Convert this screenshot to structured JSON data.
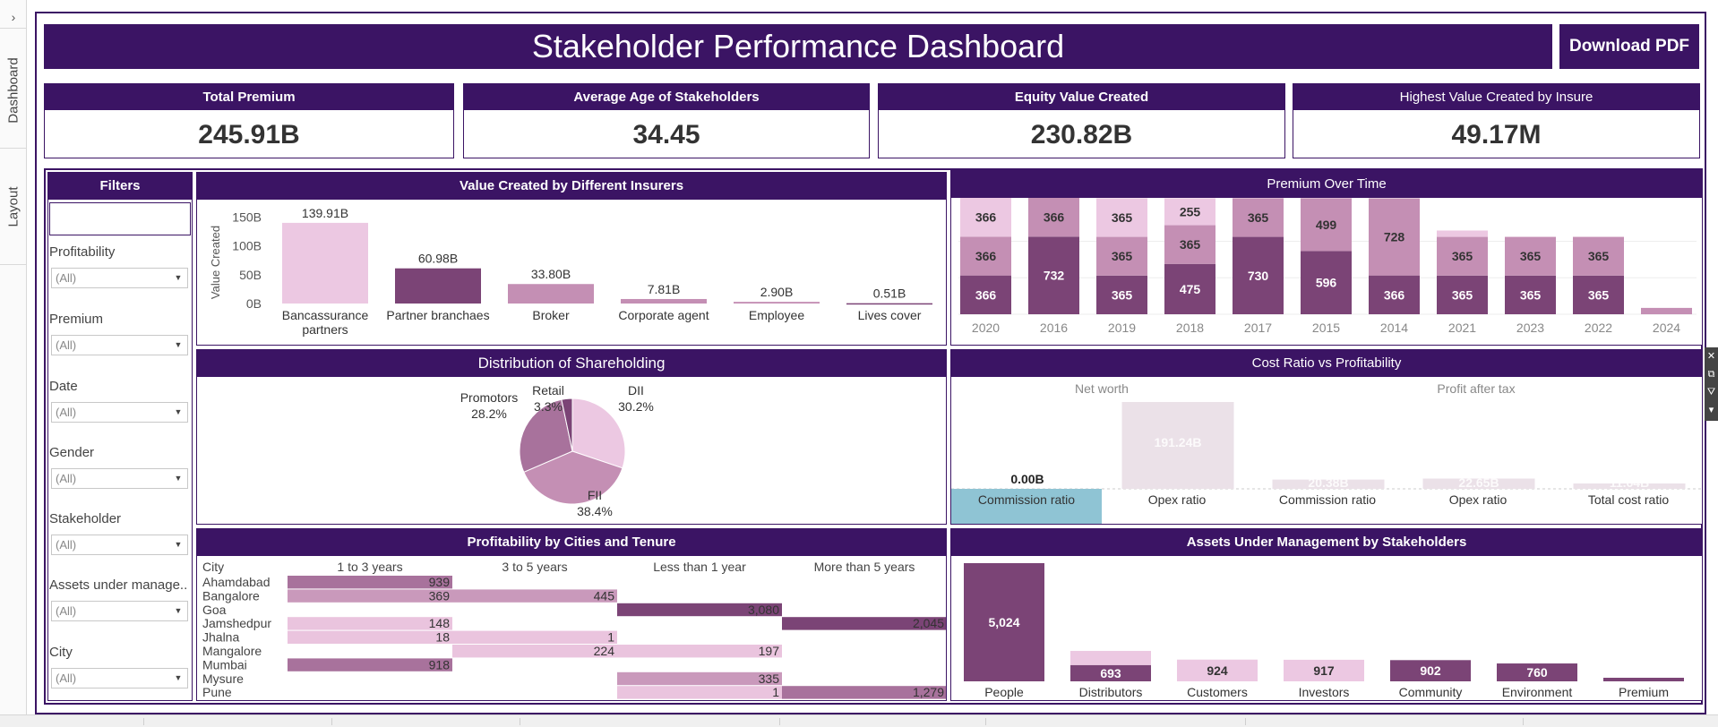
{
  "nav": {
    "expand_glyph": "›",
    "tabs": [
      "Dashboard",
      "Layout"
    ]
  },
  "header": {
    "title": "Stakeholder Performance Dashboard",
    "download_label": "Download PDF"
  },
  "kpis": [
    {
      "label": "Total Premium",
      "value": "245.91B"
    },
    {
      "label": "Average Age of Stakeholders",
      "value": "34.45"
    },
    {
      "label": "Equity  Value Created",
      "value": "230.82B"
    },
    {
      "label": "Highest Value Created by Insure",
      "value": "49.17M"
    }
  ],
  "filters": {
    "title": "Filters",
    "items": [
      {
        "label": "Profitability",
        "value": "(All)"
      },
      {
        "label": "Premium",
        "value": "(All)"
      },
      {
        "label": "Date",
        "value": "(All)"
      },
      {
        "label": "Gender",
        "value": "(All)"
      },
      {
        "label": "Stakeholder",
        "value": "(All)"
      },
      {
        "label": "Assets under manage..",
        "value": "(All)"
      },
      {
        "label": "City",
        "value": "(All)"
      }
    ]
  },
  "panels": {
    "value_created": "Value Created by Different Insurers",
    "premium_over_time": "Premium Over Time",
    "shareholding": "Distribution of Shareholding",
    "cost_ratio": "Cost Ratio vs Profitability",
    "profitability_cities": "Profitability by Cities and Tenure",
    "aum": "Assets Under Management by Stakeholders"
  },
  "colors": {
    "brand": "#3b1464",
    "light": "#ecc8e2",
    "mid": "#c48fb4",
    "dark": "#7b4476",
    "teal": "#8fc4d4"
  },
  "chart_data": [
    {
      "id": "value-created",
      "type": "bar",
      "title": "Value Created by Different Insurers",
      "ylabel": "Value Created",
      "yticks": [
        "150B",
        "100B",
        "50B",
        "0B"
      ],
      "ylim": [
        0,
        160
      ],
      "categories": [
        [
          "Bancassurance",
          "partners"
        ],
        [
          "Partner branchaes"
        ],
        [
          "Broker"
        ],
        [
          "Corporate agent"
        ],
        [
          "Employee"
        ],
        [
          "Lives cover"
        ]
      ],
      "values": [
        139.91,
        60.98,
        33.8,
        7.81,
        2.9,
        0.51
      ],
      "labels": [
        "139.91B",
        "60.98B",
        "33.80B",
        "7.81B",
        "2.90B",
        "0.51B"
      ],
      "shades": [
        "light",
        "dark",
        "mid",
        "mid",
        "mid",
        "dark"
      ]
    },
    {
      "id": "premium-over-time",
      "type": "bar",
      "stacked": true,
      "title": "Premium Over Time",
      "categories": [
        "2020",
        "2016",
        "2019",
        "2018",
        "2017",
        "2015",
        "2014",
        "2021",
        "2023",
        "2022",
        "2024"
      ],
      "series": [
        {
          "shade": "dark",
          "values": [
            366,
            732,
            365,
            475,
            730,
            596,
            366,
            365,
            365,
            365,
            0
          ]
        },
        {
          "shade": "mid",
          "values": [
            366,
            0,
            365,
            365,
            0,
            0,
            728,
            365,
            365,
            365,
            0
          ]
        },
        {
          "shade": "light",
          "values": [
            366,
            366,
            365,
            255,
            365,
            499,
            0,
            60,
            0,
            0,
            60
          ]
        }
      ],
      "segment_labels": [
        [
          "366",
          "366",
          "366"
        ],
        [
          "732",
          "",
          "366"
        ],
        [
          "365",
          "365",
          "365"
        ],
        [
          "475",
          "365",
          "255"
        ],
        [
          "730",
          "",
          "365"
        ],
        [
          "596",
          "",
          "499"
        ],
        [
          "366",
          "728",
          ""
        ],
        [
          "365",
          "365",
          ""
        ],
        [
          "365",
          "365",
          ""
        ],
        [
          "365",
          "365",
          ""
        ],
        [
          "",
          "",
          ""
        ]
      ],
      "top_shade_overrides": [
        null,
        "mid",
        null,
        null,
        "mid",
        "mid",
        null,
        null,
        null,
        null,
        "mid"
      ]
    },
    {
      "id": "shareholding",
      "type": "pie",
      "title": "Distribution of Shareholding",
      "slices": [
        {
          "label": "DII",
          "pct": "30.2%",
          "value": 30.2,
          "shade": "light"
        },
        {
          "label": "FII",
          "pct": "38.4%",
          "value": 38.4,
          "shade": "mid"
        },
        {
          "label": "Promotors",
          "pct": "28.2%",
          "value": 28.2,
          "shade": "midDark"
        },
        {
          "label": "Retail",
          "pct": "3.3%",
          "value": 3.3,
          "shade": "dark"
        }
      ]
    },
    {
      "id": "cost-ratio",
      "type": "bar",
      "title": "Cost Ratio vs Profitability",
      "groups": [
        "Net worth",
        "Profit after tax"
      ],
      "bars": [
        {
          "group": 0,
          "category": "Commission ratio",
          "value": 0.0,
          "label": "0.00B",
          "highlight": true
        },
        {
          "group": 0,
          "category": "Opex ratio",
          "value": 191.24,
          "label": "191.24B"
        },
        {
          "group": 1,
          "category": "Commission ratio",
          "value": 20.38,
          "label": "20.38B"
        },
        {
          "group": 1,
          "category": "Opex ratio",
          "value": 22.65,
          "label": "22.65B"
        },
        {
          "group": 1,
          "category": "Total cost ratio",
          "value": 11.64,
          "label": "11.64B"
        }
      ]
    },
    {
      "id": "profitability-cities",
      "type": "table",
      "title": "Profitability by Cities and Tenure",
      "row_header": "City",
      "columns": [
        "1 to 3 years",
        "3 to 5 years",
        "Less than 1 year",
        "More than 5 years"
      ],
      "rows": [
        {
          "city": "Ahamdabad",
          "cells": [
            939,
            null,
            null,
            null
          ]
        },
        {
          "city": "Bangalore",
          "cells": [
            369,
            445,
            null,
            null
          ]
        },
        {
          "city": "Goa",
          "cells": [
            null,
            null,
            3080,
            null
          ]
        },
        {
          "city": "Jamshedpur",
          "cells": [
            148,
            null,
            null,
            2045
          ]
        },
        {
          "city": "Jhalna",
          "cells": [
            18,
            1,
            null,
            null
          ]
        },
        {
          "city": "Mangalore",
          "cells": [
            null,
            224,
            197,
            null
          ]
        },
        {
          "city": "Mumbai",
          "cells": [
            918,
            null,
            null,
            null
          ]
        },
        {
          "city": "Mysure",
          "cells": [
            null,
            null,
            335,
            null
          ]
        },
        {
          "city": "Pune",
          "cells": [
            null,
            null,
            1,
            1279
          ]
        }
      ],
      "cell_text": [
        [
          "939",
          "",
          "",
          ""
        ],
        [
          "369",
          "445",
          "",
          ""
        ],
        [
          "",
          "",
          "3,080",
          ""
        ],
        [
          "148",
          "",
          "",
          "2,045"
        ],
        [
          "18",
          "1",
          "",
          ""
        ],
        [
          "",
          "224",
          "197",
          ""
        ],
        [
          "918",
          "",
          "",
          ""
        ],
        [
          "",
          "",
          "335",
          ""
        ],
        [
          "",
          "",
          "1",
          "1,279"
        ]
      ]
    },
    {
      "id": "aum",
      "type": "bar",
      "stacked": true,
      "title": "Assets Under Management by Stakeholders",
      "categories": [
        "People",
        "Distributors",
        "Customers",
        "Investors",
        "Community",
        "Environment",
        "Premium"
      ],
      "values": [
        5024,
        693,
        924,
        917,
        902,
        760,
        0
      ],
      "labels": [
        "5,024",
        "693",
        "924",
        "917",
        "902",
        "760",
        ""
      ],
      "bottom_shades": [
        "dark",
        "dark",
        "light",
        "light",
        "dark",
        "dark",
        "dark"
      ],
      "top_shade": "light",
      "extra_top": [
        0,
        600,
        0,
        0,
        0,
        0,
        0
      ]
    }
  ]
}
